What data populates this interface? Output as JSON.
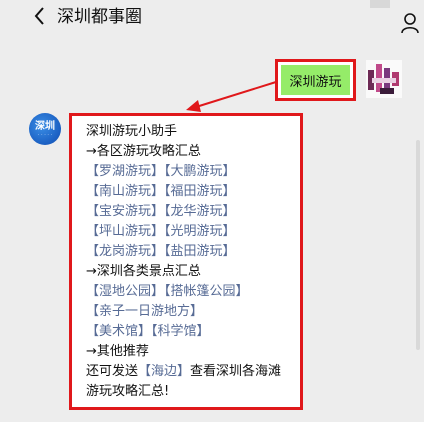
{
  "header": {
    "title": "深圳都事圈",
    "back_icon": "chevron-left-icon",
    "profile_icon": "person-icon"
  },
  "outgoing": {
    "text": "深圳游玩"
  },
  "bot": {
    "avatar_line1": "深圳",
    "avatar_line2": "· · · · ·",
    "lines": [
      {
        "parts": [
          {
            "t": "深圳游玩小助手",
            "link": false
          }
        ]
      },
      {
        "parts": [
          {
            "t": "→各区游玩攻略汇总",
            "link": false
          }
        ]
      },
      {
        "parts": [
          {
            "t": "【罗湖游玩】",
            "link": true
          },
          {
            "t": "【大鹏游玩】",
            "link": true
          }
        ]
      },
      {
        "parts": [
          {
            "t": "【南山游玩】",
            "link": true
          },
          {
            "t": "【福田游玩】",
            "link": true
          }
        ]
      },
      {
        "parts": [
          {
            "t": "【宝安游玩】",
            "link": true
          },
          {
            "t": "【龙华游玩】",
            "link": true
          }
        ]
      },
      {
        "parts": [
          {
            "t": "【坪山游玩】",
            "link": true
          },
          {
            "t": "【光明游玩】",
            "link": true
          }
        ]
      },
      {
        "parts": [
          {
            "t": "【龙岗游玩】",
            "link": true
          },
          {
            "t": "【盐田游玩】",
            "link": true
          }
        ]
      },
      {
        "parts": [
          {
            "t": "→深圳各类景点汇总",
            "link": false
          }
        ]
      },
      {
        "parts": [
          {
            "t": "【湿地公园】",
            "link": true
          },
          {
            "t": "【搭帐篷公园】",
            "link": true
          }
        ]
      },
      {
        "parts": [
          {
            "t": "【亲子一日游地方】",
            "link": true
          }
        ]
      },
      {
        "parts": [
          {
            "t": "【美术馆】",
            "link": true
          },
          {
            "t": "【科学馆】",
            "link": true
          }
        ]
      },
      {
        "parts": [
          {
            "t": "→其他推荐",
            "link": false
          }
        ]
      },
      {
        "parts": [
          {
            "t": "还可发送",
            "link": false
          },
          {
            "t": "【海边】",
            "link": true
          },
          {
            "t": "查看深圳各海滩",
            "link": false
          }
        ]
      },
      {
        "parts": [
          {
            "t": "游玩攻略汇总!",
            "link": false
          }
        ]
      }
    ]
  },
  "colors": {
    "annotation": "#e0181b",
    "link": "#576b95",
    "bubble_green": "#95ec69",
    "background": "#ededed"
  }
}
